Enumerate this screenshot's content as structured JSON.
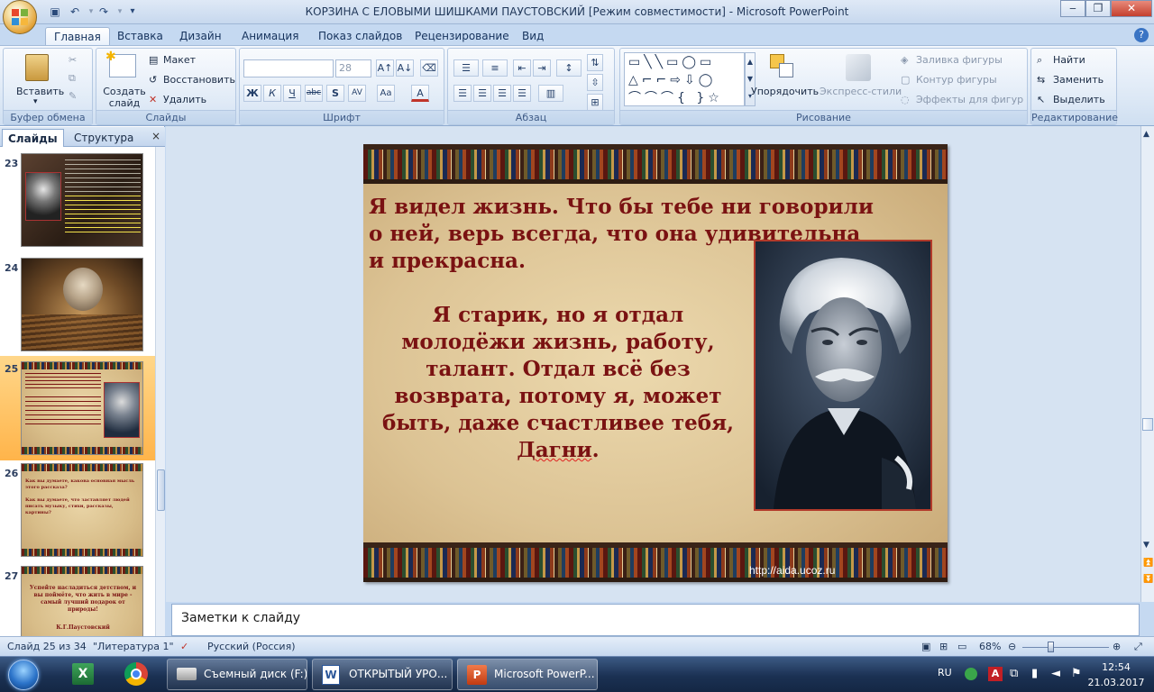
{
  "window": {
    "title": "КОРЗИНА С ЕЛОВЫМИ ШИШКАМИ ПАУСТОВСКИЙ [Режим совместимости] - Microsoft PowerPoint"
  },
  "ribbon_tabs": [
    "Главная",
    "Вставка",
    "Дизайн",
    "Анимация",
    "Показ слайдов",
    "Рецензирование",
    "Вид"
  ],
  "ribbon": {
    "clipboard": {
      "paste_label": "Вставить",
      "group_label": "Буфер обмена"
    },
    "slides": {
      "new_slide_label": "Создать слайд",
      "layout_label": "Макет",
      "reset_label": "Восстановить",
      "delete_label": "Удалить",
      "group_label": "Слайды"
    },
    "font": {
      "size_value": "28",
      "group_label": "Шрифт"
    },
    "paragraph": {
      "group_label": "Абзац"
    },
    "drawing": {
      "arrange_label": "Упорядочить",
      "quick_styles_label": "Экспресс-стили",
      "fill_label": "Заливка фигуры",
      "outline_label": "Контур фигуры",
      "effects_label": "Эффекты для фигур",
      "group_label": "Рисование"
    },
    "editing": {
      "find_label": "Найти",
      "replace_label": "Заменить",
      "select_label": "Выделить",
      "group_label": "Редактирование"
    }
  },
  "panel": {
    "tabs": [
      "Слайды",
      "Структура"
    ],
    "close_symbol": "×",
    "thumbnails": [
      {
        "number": "23"
      },
      {
        "number": "24"
      },
      {
        "number": "25",
        "selected": true
      },
      {
        "number": "26",
        "text": "Как вы думаете, какова основная мысль этого рассказа?\n\nКак вы думаете, что заставляет людей писать музыку, стихи, рассказы, картины?"
      },
      {
        "number": "27",
        "text": "Успейте насладиться детством, и вы поймёте, что жить в мире - самый лучший подарок от природы!",
        "author": "К.Г.Паустовский"
      }
    ]
  },
  "slide": {
    "quote1": "Я видел жизнь. Что бы тебе ни говорили о ней, верь всегда, что она удивительна и прекрасна.",
    "quote2_main": "Я старик, но я отдал молодёжи жизнь, работу, талант. Отдал всё без возврата, потому я, может быть, даже счастливее тебя, ",
    "quote2_name": "Дагни",
    "quote2_end": ".",
    "site_url": "http://aida.ucoz.ru"
  },
  "notes": {
    "placeholder": "Заметки к слайду"
  },
  "statusbar": {
    "slide_counter": "Слайд 25 из 34",
    "theme": "\"Литература 1\"",
    "language": "Русский (Россия)",
    "zoom": "68%"
  },
  "taskbar": {
    "tasks": [
      "Съемный диск (F:)",
      "ОТКРЫТЫЙ УРО...",
      "Microsoft PowerP..."
    ],
    "language": "RU",
    "time": "12:54",
    "date": "21.03.2017"
  }
}
